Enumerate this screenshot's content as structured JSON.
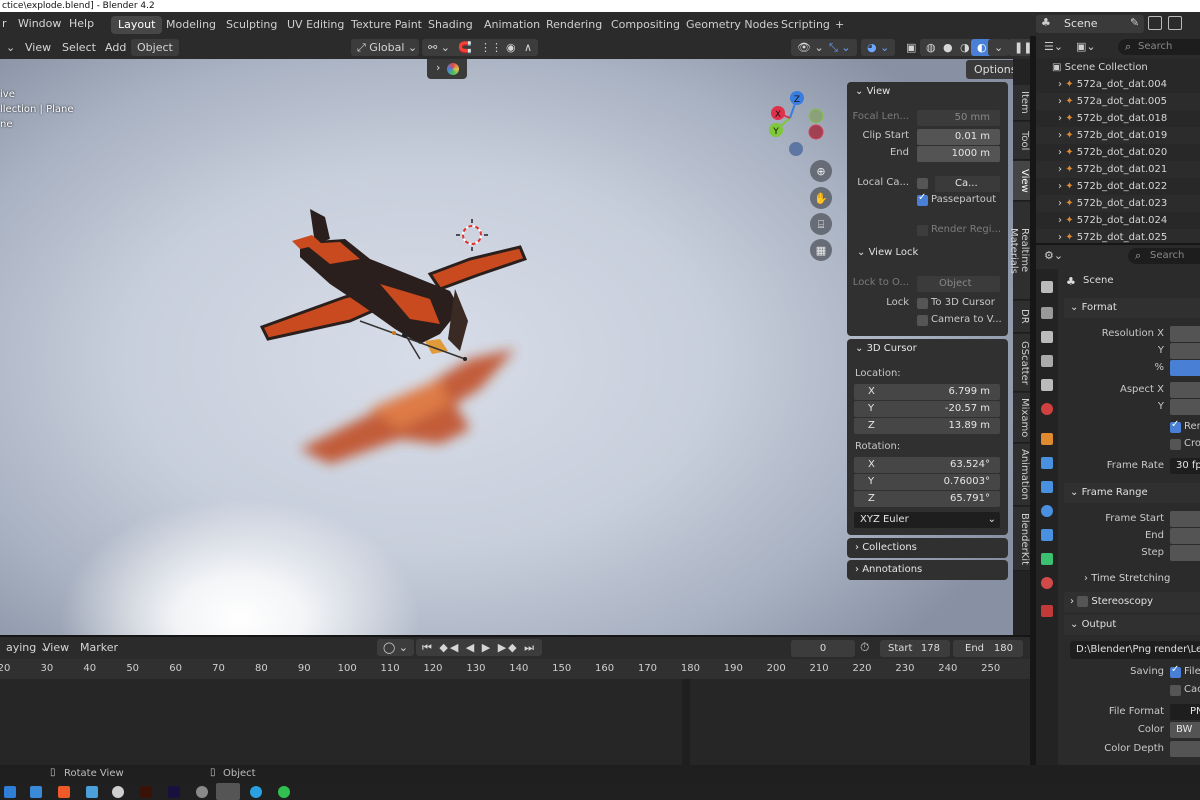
{
  "window": {
    "title": "ctice\\explode.blend] - Blender 4.2"
  },
  "menu": {
    "items": [
      "r",
      "Window",
      "Help"
    ],
    "workspaces": [
      "Layout",
      "Modeling",
      "Sculpting",
      "UV Editing",
      "Texture Paint",
      "Shading",
      "Animation",
      "Rendering",
      "Compositing",
      "Geometry Nodes",
      "Scripting"
    ],
    "add_tab": "+",
    "scene_name": "Scene"
  },
  "viewport_header": {
    "menus": [
      "View",
      "Select",
      "Add",
      "Object"
    ],
    "orientation": "Global",
    "options_label": "Options"
  },
  "viewport_overlay": {
    "lines": [
      "ive",
      "llection | Plane",
      "ne"
    ]
  },
  "gizmo": {
    "x": "X",
    "y": "Y",
    "z": "Z"
  },
  "npanel": {
    "view": {
      "title": "View",
      "focal_label": "Focal Len...",
      "focal_value": "50 mm",
      "clip_start_label": "Clip Start",
      "clip_start_value": "0.01 m",
      "end_label": "End",
      "end_value": "1000 m",
      "local_camera_label": "Local Ca...",
      "local_camera_value": "Ca...",
      "passepartout_label": "Passepartout",
      "render_region_label": "Render Regi..."
    },
    "view_lock": {
      "title": "View Lock",
      "lock_to_label": "Lock to O...",
      "lock_to_value": "Object",
      "lock_label": "Lock",
      "to_3d_cursor": "To 3D Cursor",
      "camera_to_view": "Camera to V..."
    },
    "cursor": {
      "title": "3D Cursor",
      "location_label": "Location:",
      "loc_x_label": "X",
      "loc_x": "6.799 m",
      "loc_y_label": "Y",
      "loc_y": "-20.57 m",
      "loc_z_label": "Z",
      "loc_z": "13.89 m",
      "rotation_label": "Rotation:",
      "rot_x_label": "X",
      "rot_x": "63.524°",
      "rot_y_label": "Y",
      "rot_y": "0.76003°",
      "rot_z_label": "Z",
      "rot_z": "65.791°",
      "rotation_mode": "XYZ Euler"
    },
    "collections_title": "Collections",
    "annotations_title": "Annotations"
  },
  "vertical_tabs": [
    "Item",
    "Tool",
    "View",
    "Realtime Materials",
    "DR",
    "GScatter",
    "Mixamo",
    "Animation",
    "BlenderKit"
  ],
  "timeline": {
    "playback_label": "aying",
    "view_label": "View",
    "marker_label": "Marker",
    "current_frame": "0",
    "start_label": "Start",
    "start_value": "178",
    "end_label": "End",
    "end_value": "180",
    "ticks": [
      "20",
      "30",
      "40",
      "50",
      "60",
      "70",
      "80",
      "90",
      "100",
      "110",
      "120",
      "130",
      "140",
      "150",
      "160",
      "170",
      "180",
      "190",
      "200",
      "210",
      "220",
      "230",
      "240",
      "250"
    ]
  },
  "statusbar": {
    "rotate_view": "Rotate View",
    "object": "Object"
  },
  "outliner": {
    "search_placeholder": "Search",
    "root": "Scene Collection",
    "items": [
      "572a_dot_dat.004",
      "572a_dot_dat.005",
      "572b_dot_dat.018",
      "572b_dot_dat.019",
      "572b_dot_dat.020",
      "572b_dot_dat.021",
      "572b_dot_dat.022",
      "572b_dot_dat.023",
      "572b_dot_dat.024",
      "572b_dot_dat.025"
    ]
  },
  "properties": {
    "search_placeholder": "Search",
    "context": "Scene",
    "format": {
      "title": "Format",
      "resolution_x": "Resolution X",
      "y": "Y",
      "percent": "%",
      "aspect_x": "Aspect X",
      "aspect_y": "Y",
      "render_region": "Ren",
      "crop": "Cro",
      "frame_rate_label": "Frame Rate",
      "frame_rate_value": "30 fp"
    },
    "frame_range": {
      "title": "Frame Range",
      "frame_start": "Frame Start",
      "end": "End",
      "step": "Step",
      "time_stretching": "Time Stretching"
    },
    "stereoscopy": "Stereoscopy",
    "output": {
      "title": "Output",
      "path": "D:\\Blender\\Png render\\Leg",
      "saving_label": "Saving",
      "file_ext": "File",
      "cache": "Cac",
      "file_format_label": "File Format",
      "file_format_value": "PN",
      "color_label": "Color",
      "color_value": "BW",
      "color_depth_label": "Color Depth"
    }
  },
  "colors": {
    "accent_blue": "#4a7fd6",
    "axis_x": "#e0304a",
    "axis_y": "#7ec83a",
    "axis_z": "#3a7de0",
    "plane_body": "#c94a1e",
    "plane_dark": "#2a1f1c"
  }
}
